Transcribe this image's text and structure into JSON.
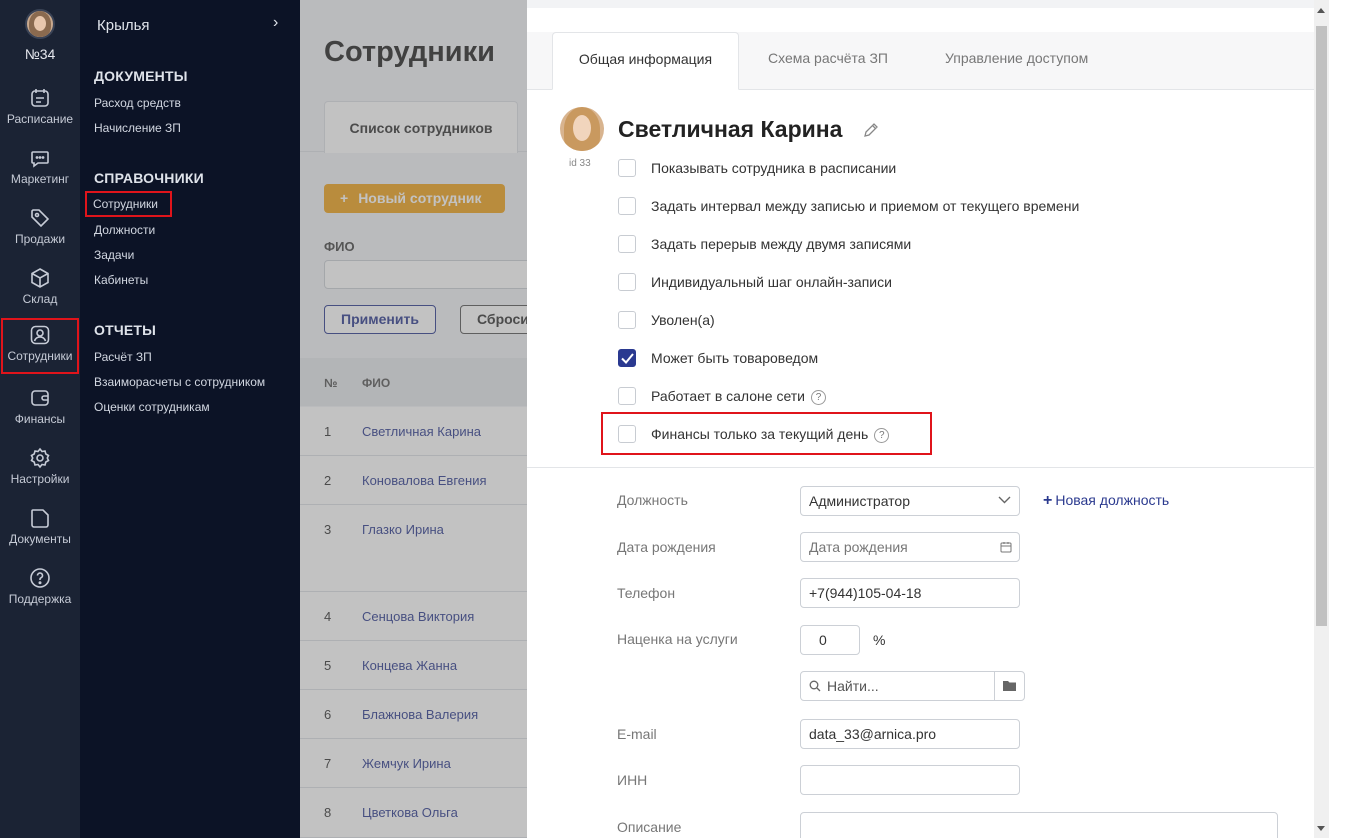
{
  "rail": {
    "salon_number": "№34",
    "items": [
      {
        "label": "Расписание",
        "icon": "calendar-icon"
      },
      {
        "label": "Маркетинг",
        "icon": "chat-icon"
      },
      {
        "label": "Продажи",
        "icon": "tag-icon"
      },
      {
        "label": "Склад",
        "icon": "box-icon"
      },
      {
        "label": "Сотрудники",
        "icon": "user-icon",
        "active": true
      },
      {
        "label": "Финансы",
        "icon": "wallet-icon"
      },
      {
        "label": "Настройки",
        "icon": "gear-icon"
      },
      {
        "label": "Документы",
        "icon": "document-icon"
      },
      {
        "label": "Поддержка",
        "icon": "help-icon"
      }
    ]
  },
  "menu": {
    "breadcrumb": "Крылья",
    "sections": [
      {
        "title": "ДОКУМЕНТЫ",
        "links": [
          "Расход средств",
          "Начисление ЗП"
        ]
      },
      {
        "title": "СПРАВОЧНИКИ",
        "links": [
          "Сотрудники",
          "Должности",
          "Задачи",
          "Кабинеты"
        ]
      },
      {
        "title": "ОТЧЕТЫ",
        "links": [
          "Расчёт ЗП",
          "Взаиморасчеты с сотрудником",
          "Оценки сотрудникам"
        ]
      }
    ]
  },
  "page": {
    "title": "Сотрудники",
    "tab": "Список сотрудников",
    "new_button": "Новый сотрудник",
    "fio_label": "ФИО",
    "apply_button": "Применить",
    "reset_button": "Сбросить",
    "table": {
      "headers": [
        "№",
        "ФИО"
      ],
      "rows": [
        {
          "n": "1",
          "name": "Светличная Карина"
        },
        {
          "n": "2",
          "name": "Коновалова Евгения"
        },
        {
          "n": "3",
          "name": "Глазко Ирина"
        },
        {
          "n": "4",
          "name": "Сенцова Виктория"
        },
        {
          "n": "5",
          "name": "Концева Жанна"
        },
        {
          "n": "6",
          "name": "Блажнова Валерия"
        },
        {
          "n": "7",
          "name": "Жемчук Ирина"
        },
        {
          "n": "8",
          "name": "Цветкова Ольга"
        }
      ]
    }
  },
  "modal": {
    "tabs": [
      "Общая информация",
      "Схема расчёта ЗП",
      "Управление доступом"
    ],
    "employee_name": "Светличная Карина",
    "employee_id": "id 33",
    "checkboxes": [
      {
        "label": "Показывать сотрудника в расписании",
        "checked": false
      },
      {
        "label": "Задать интервал между записью и приемом от текущего времени",
        "checked": false
      },
      {
        "label": "Задать перерыв между двумя записями",
        "checked": false
      },
      {
        "label": "Индивидуальный шаг онлайн-записи",
        "checked": false
      },
      {
        "label": "Уволен(а)",
        "checked": false
      },
      {
        "label": "Может быть товароведом",
        "checked": true
      },
      {
        "label": "Работает в салоне сети",
        "checked": false,
        "help": "?"
      },
      {
        "label": "Финансы только за текущий день",
        "checked": false,
        "help": "?"
      }
    ],
    "fields": {
      "position_label": "Должность",
      "position_value": "Администратор",
      "new_position": "Новая должность",
      "birthdate_label": "Дата рождения",
      "birthdate_placeholder": "Дата рождения",
      "phone_label": "Телефон",
      "phone_value": "+7(944)105-04-18",
      "markup_label": "Наценка на услуги",
      "markup_value": "0",
      "markup_unit": "%",
      "search_placeholder": "Найти...",
      "email_label": "E-mail",
      "email_value": "data_33@arnica.pro",
      "inn_label": "ИНН",
      "inn_value": "",
      "description_label": "Описание"
    }
  },
  "colors": {
    "rail_bg": "#1b2334",
    "menu_bg": "#0c1326",
    "accent_orange": "#f0a21a",
    "link_blue": "#2b3a8f",
    "highlight_red": "#e0141b"
  }
}
